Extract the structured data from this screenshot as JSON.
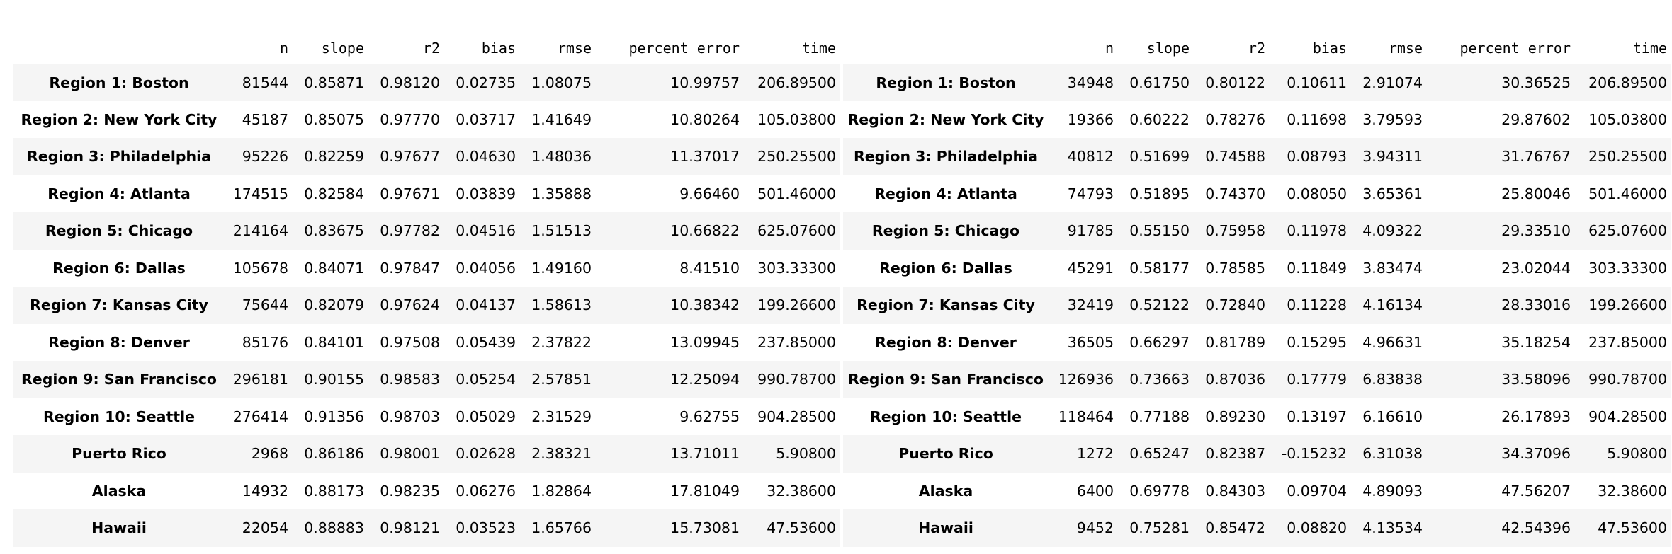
{
  "tables": [
    {
      "columns": [
        "",
        "n",
        "slope",
        "r2",
        "bias",
        "rmse",
        "percent error",
        "time"
      ],
      "rows": [
        [
          "Region 1: Boston",
          "81544",
          "0.85871",
          "0.98120",
          "0.02735",
          "1.08075",
          "10.99757",
          "206.89500"
        ],
        [
          "Region 2: New York City",
          "45187",
          "0.85075",
          "0.97770",
          "0.03717",
          "1.41649",
          "10.80264",
          "105.03800"
        ],
        [
          "Region 3: Philadelphia",
          "95226",
          "0.82259",
          "0.97677",
          "0.04630",
          "1.48036",
          "11.37017",
          "250.25500"
        ],
        [
          "Region 4: Atlanta",
          "174515",
          "0.82584",
          "0.97671",
          "0.03839",
          "1.35888",
          "9.66460",
          "501.46000"
        ],
        [
          "Region 5: Chicago",
          "214164",
          "0.83675",
          "0.97782",
          "0.04516",
          "1.51513",
          "10.66822",
          "625.07600"
        ],
        [
          "Region 6: Dallas",
          "105678",
          "0.84071",
          "0.97847",
          "0.04056",
          "1.49160",
          "8.41510",
          "303.33300"
        ],
        [
          "Region 7: Kansas City",
          "75644",
          "0.82079",
          "0.97624",
          "0.04137",
          "1.58613",
          "10.38342",
          "199.26600"
        ],
        [
          "Region 8: Denver",
          "85176",
          "0.84101",
          "0.97508",
          "0.05439",
          "2.37822",
          "13.09945",
          "237.85000"
        ],
        [
          "Region 9: San Francisco",
          "296181",
          "0.90155",
          "0.98583",
          "0.05254",
          "2.57851",
          "12.25094",
          "990.78700"
        ],
        [
          "Region 10: Seattle",
          "276414",
          "0.91356",
          "0.98703",
          "0.05029",
          "2.31529",
          "9.62755",
          "904.28500"
        ],
        [
          "Puerto Rico",
          "2968",
          "0.86186",
          "0.98001",
          "0.02628",
          "2.38321",
          "13.71011",
          "5.90800"
        ],
        [
          "Alaska",
          "14932",
          "0.88173",
          "0.98235",
          "0.06276",
          "1.82864",
          "17.81049",
          "32.38600"
        ],
        [
          "Hawaii",
          "22054",
          "0.88883",
          "0.98121",
          "0.03523",
          "1.65766",
          "15.73081",
          "47.53600"
        ]
      ]
    },
    {
      "columns": [
        "",
        "n",
        "slope",
        "r2",
        "bias",
        "rmse",
        "percent error",
        "time"
      ],
      "rows": [
        [
          "Region 1: Boston",
          "34948",
          "0.61750",
          "0.80122",
          "0.10611",
          "2.91074",
          "30.36525",
          "206.89500"
        ],
        [
          "Region 2: New York City",
          "19366",
          "0.60222",
          "0.78276",
          "0.11698",
          "3.79593",
          "29.87602",
          "105.03800"
        ],
        [
          "Region 3: Philadelphia",
          "40812",
          "0.51699",
          "0.74588",
          "0.08793",
          "3.94311",
          "31.76767",
          "250.25500"
        ],
        [
          "Region 4: Atlanta",
          "74793",
          "0.51895",
          "0.74370",
          "0.08050",
          "3.65361",
          "25.80046",
          "501.46000"
        ],
        [
          "Region 5: Chicago",
          "91785",
          "0.55150",
          "0.75958",
          "0.11978",
          "4.09322",
          "29.33510",
          "625.07600"
        ],
        [
          "Region 6: Dallas",
          "45291",
          "0.58177",
          "0.78585",
          "0.11849",
          "3.83474",
          "23.02044",
          "303.33300"
        ],
        [
          "Region 7: Kansas City",
          "32419",
          "0.52122",
          "0.72840",
          "0.11228",
          "4.16134",
          "28.33016",
          "199.26600"
        ],
        [
          "Region 8: Denver",
          "36505",
          "0.66297",
          "0.81789",
          "0.15295",
          "4.96631",
          "35.18254",
          "237.85000"
        ],
        [
          "Region 9: San Francisco",
          "126936",
          "0.73663",
          "0.87036",
          "0.17779",
          "6.83838",
          "33.58096",
          "990.78700"
        ],
        [
          "Region 10: Seattle",
          "118464",
          "0.77188",
          "0.89230",
          "0.13197",
          "6.16610",
          "26.17893",
          "904.28500"
        ],
        [
          "Puerto Rico",
          "1272",
          "0.65247",
          "0.82387",
          "-0.15232",
          "6.31038",
          "34.37096",
          "5.90800"
        ],
        [
          "Alaska",
          "6400",
          "0.69778",
          "0.84303",
          "0.09704",
          "4.89093",
          "47.56207",
          "32.38600"
        ],
        [
          "Hawaii",
          "9452",
          "0.75281",
          "0.85472",
          "0.08820",
          "4.13534",
          "42.54396",
          "47.53600"
        ]
      ]
    }
  ]
}
